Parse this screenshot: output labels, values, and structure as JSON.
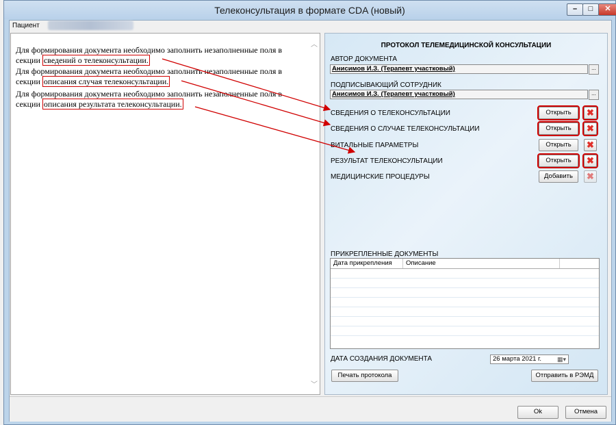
{
  "window": {
    "title": "Телеконсультация в формате CDA (новый)"
  },
  "patient": {
    "label": "Пациент"
  },
  "left_text": {
    "p1_prefix": "Для формирования документа необходимо заполнить незаполненные поля в секции",
    "p1_link": "сведений о телеконсультации.",
    "p2_prefix": "Для формирования документа необходимо заполнить незаполненные поля в секции",
    "p2_link": "описания случая телеконсультации.",
    "p3_prefix": "Для формирования документа необходимо заполнить незаполненные поля в секции",
    "p3_link": "описания результата телеконсультации."
  },
  "protocol": {
    "title": "ПРОТОКОЛ ТЕЛЕМЕДИЦИНСКОЙ КОНСУЛЬТАЦИИ",
    "author_label": "АВТОР ДОКУМЕНТА",
    "author_value": "Анисимов И.З. (Терапевт участковый)",
    "signer_label": "ПОДПИСЫВАЮЩИЙ СОТРУДНИК",
    "signer_value": "Анисимов И.З. (Терапевт участковый)",
    "ellipsis": "...",
    "sections": [
      {
        "label": "СВЕДЕНИЯ О ТЕЛЕКОНСУЛЬТАЦИИ",
        "button": "Открыть"
      },
      {
        "label": "СВЕДЕНИЯ О СЛУЧАЕ ТЕЛЕКОНСУЛЬТАЦИИ",
        "button": "Открыть"
      },
      {
        "label": "ВИТАЛЬНЫЕ ПАРАМЕТРЫ",
        "button": "Открыть"
      },
      {
        "label": "РЕЗУЛЬТАТ ТЕЛЕКОНСУЛЬТАЦИИ",
        "button": "Открыть"
      },
      {
        "label": "МЕДИЦИНСКИЕ ПРОЦЕДУРЫ",
        "button": "Добавить"
      }
    ],
    "attached_label": "ПРИКРЕПЛЕННЫЕ ДОКУМЕНТЫ",
    "attached_columns": [
      "Дата прикрепления",
      "Описание"
    ],
    "date_label": "ДАТА СОЗДАНИЯ ДОКУМЕНТА",
    "date_value": "26  марта  2021 г.",
    "print_button": "Печать протокола",
    "send_button": "Отправить в РЭМД"
  },
  "footer": {
    "ok": "Ok",
    "cancel": "Отмена"
  },
  "colors": {
    "accent_red": "#d00000",
    "panel_blue": "#d6e8f5"
  }
}
